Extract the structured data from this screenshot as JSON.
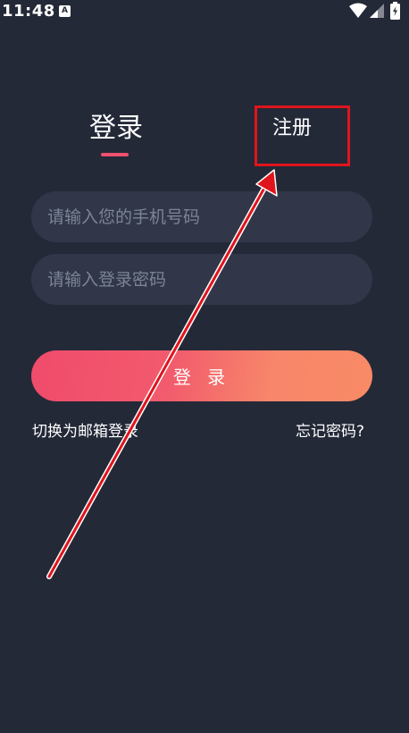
{
  "status_bar": {
    "time": "11:48",
    "notification_glyph": "A",
    "icons": [
      "wifi-icon",
      "signal-icon",
      "battery-icon"
    ]
  },
  "tabs": {
    "login": "登录",
    "register": "注册"
  },
  "form": {
    "phone_placeholder": "请输入您的手机号码",
    "password_placeholder": "请输入登录密码",
    "login_button": "登 录",
    "switch_email": "切换为邮箱登录",
    "forgot_password": "忘记密码?"
  },
  "colors": {
    "background": "#242938",
    "input_bg": "#313749",
    "accent": "#f0506e",
    "gradient_end": "#f98a66",
    "annotation": "#e0141c"
  }
}
